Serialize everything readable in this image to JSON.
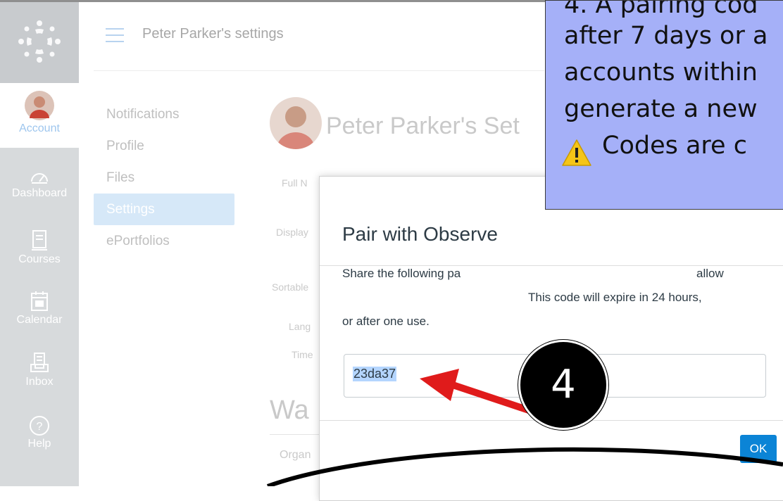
{
  "nav": {
    "items": [
      {
        "label": "Account",
        "icon": "avatar",
        "active": true
      },
      {
        "label": "Dashboard",
        "icon": "dashboard-icon"
      },
      {
        "label": "Courses",
        "icon": "book-icon"
      },
      {
        "label": "Calendar",
        "icon": "calendar-icon"
      },
      {
        "label": "Inbox",
        "icon": "inbox-icon"
      },
      {
        "label": "Help",
        "icon": "help-icon"
      }
    ]
  },
  "header": {
    "breadcrumb": "Peter Parker's settings"
  },
  "section_menu": {
    "items": [
      {
        "label": "Notifications"
      },
      {
        "label": "Profile"
      },
      {
        "label": "Files"
      },
      {
        "label": "Settings",
        "active": true
      },
      {
        "label": "ePortfolios"
      }
    ]
  },
  "background": {
    "title": "Peter Parker's Set",
    "labels": {
      "full_name": "Full N",
      "display": "Display",
      "sortable": "Sortable",
      "language": "Lang",
      "time": "Time"
    },
    "ways": "Wa",
    "org": "Organ"
  },
  "modal": {
    "title": "Pair with Observe",
    "text_line1a": "Share the following pa",
    "text_line1b": "allow",
    "text_line2": "This code will expire in 24 hours,",
    "text_line3": "or after one use.",
    "code": "23da37",
    "ok_label": "OK"
  },
  "callout": {
    "line1": "4. A pairing cod",
    "line2": "after 7 days or a",
    "line3": "accounts within",
    "line4": "generate a new",
    "line5": "Codes are c"
  },
  "step": {
    "number": "4"
  },
  "colors": {
    "accent": "#0b84d6",
    "callout_bg": "#a5b0f8",
    "arrow": "#e01b1b"
  }
}
